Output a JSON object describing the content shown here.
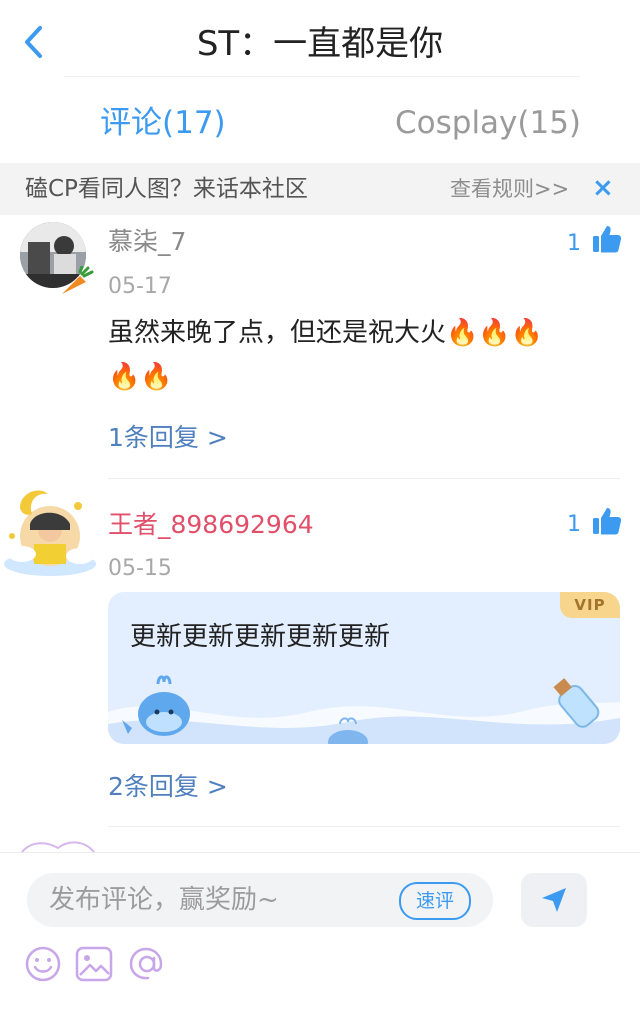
{
  "header": {
    "title": "ST：一直都是你"
  },
  "tabs": [
    {
      "label": "评论(17)"
    },
    {
      "label": "Cosplay(15)"
    }
  ],
  "banner": {
    "text": "磕CP看同人图？来话本社区",
    "link": "查看规则>>",
    "close": "×"
  },
  "comments": [
    {
      "username": "慕柒_7",
      "date": "05-17",
      "likes": "1",
      "text_line1": "虽然来晚了点，但还是祝大火🔥🔥🔥",
      "text_line2": "🔥🔥",
      "replies": "1条回复 >"
    },
    {
      "username": "王者_898692964",
      "date": "05-15",
      "likes": "1",
      "text": "更新更新更新更新更新",
      "vip_badge": "VIP",
      "replies": "2条回复 >"
    }
  ],
  "composer": {
    "placeholder": "发布评论，赢奖励~",
    "quick_label": "速评"
  },
  "colors": {
    "accent": "#3c9bf0",
    "username_vip": "#e0506a",
    "reply": "#4f7fbf"
  }
}
